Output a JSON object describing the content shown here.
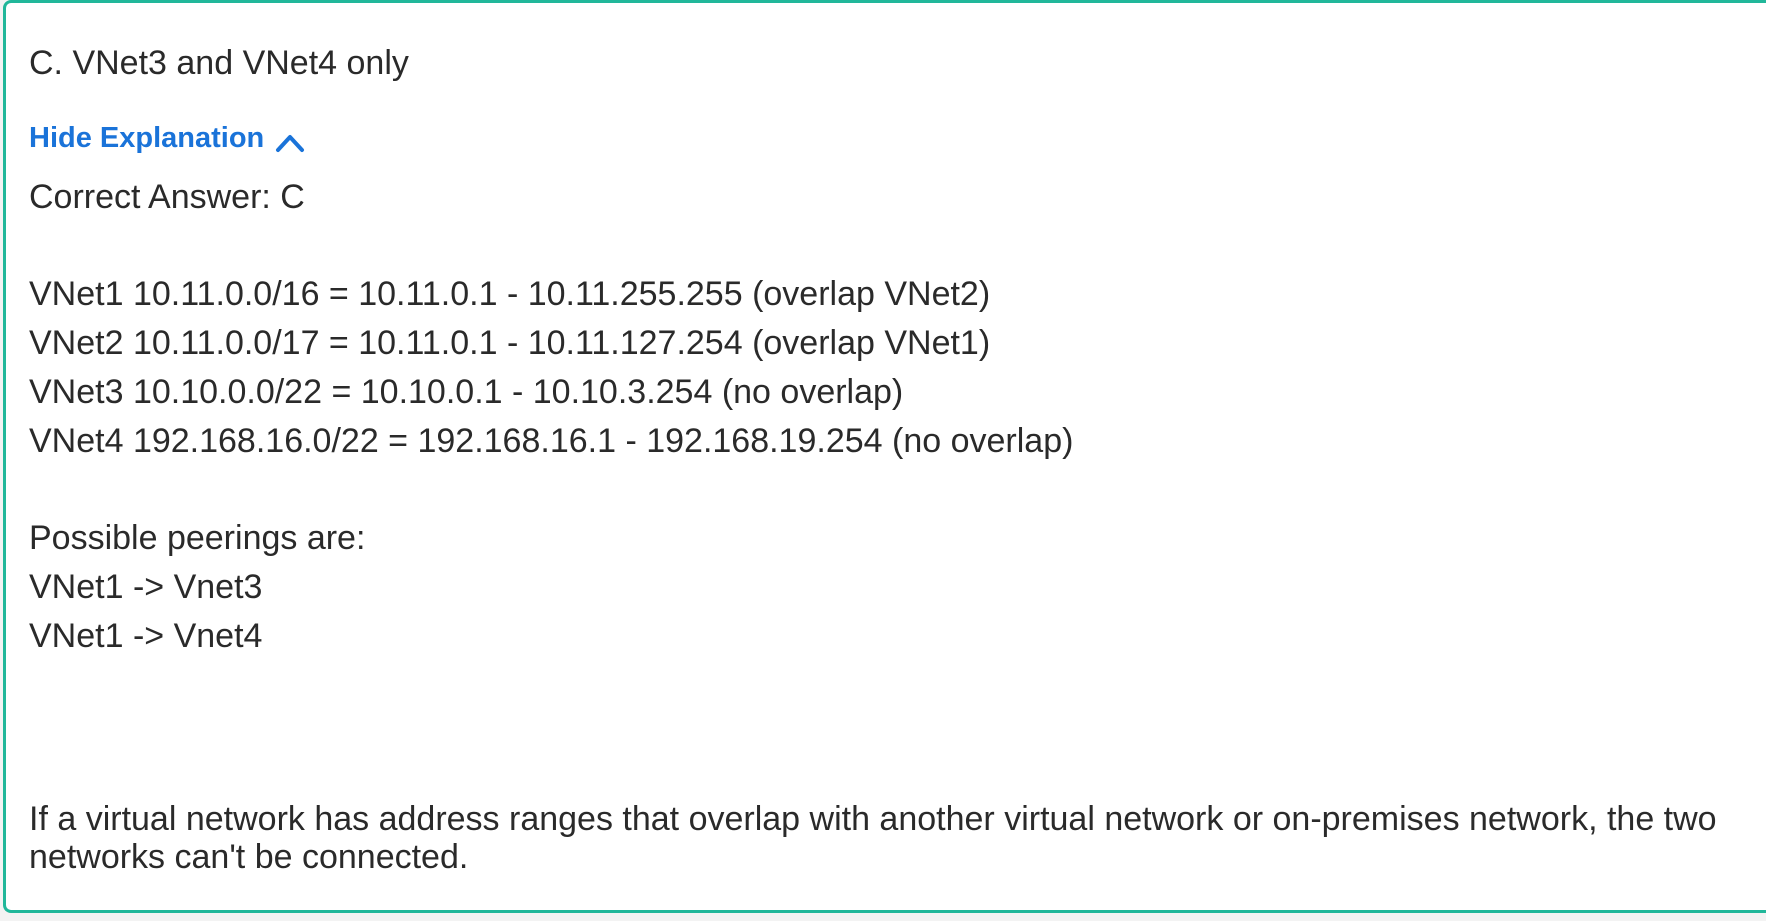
{
  "answer_option": "C. VNet3 and VNet4 only",
  "explanation_toggle": {
    "label": "Hide Explanation",
    "icon": "chevron-up-icon",
    "color": "#1a73d9"
  },
  "correct_answer": "Correct Answer: C",
  "ranges": [
    "VNet1 10.11.0.0/16 = 10.11.0.1 - 10.11.255.255 (overlap VNet2)",
    "VNet2 10.11.0.0/17 = 10.11.0.1 - 10.11.127.254 (overlap VNet1)",
    "VNet3 10.10.0.0/22 = 10.10.0.1 - 10.10.3.254 (no overlap)",
    "VNet4 192.168.16.0/22 = 192.168.16.1 - 192.168.19.254 (no overlap)"
  ],
  "peerings": {
    "heading": "Possible peerings are:",
    "items": [
      "VNet1 -> Vnet3",
      "VNet1 -> Vnet4"
    ]
  },
  "note": "If a virtual network has address ranges that overlap with another virtual network or on-premises network, the two networks can't be connected.",
  "colors": {
    "border": "#21b79a",
    "text": "#2a2a2a",
    "link": "#1a73d9"
  }
}
